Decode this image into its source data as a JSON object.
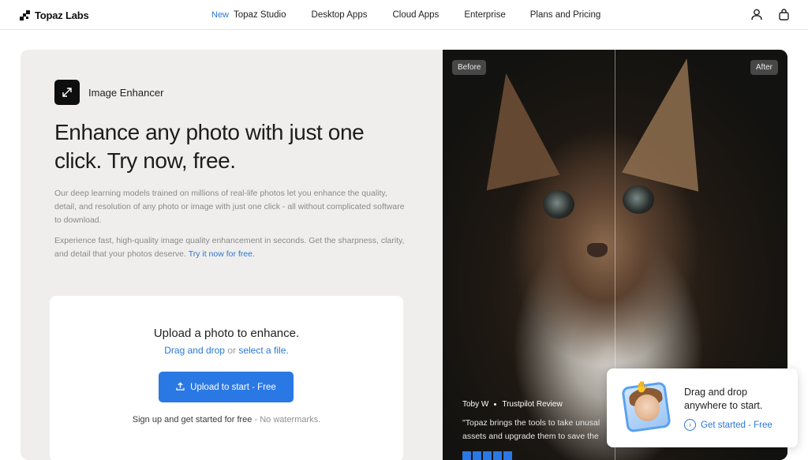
{
  "nav": {
    "logo_text": "Topaz Labs",
    "new_tag": "New",
    "items": [
      {
        "label": "Topaz Studio"
      },
      {
        "label": "Desktop Apps"
      },
      {
        "label": "Cloud Apps"
      },
      {
        "label": "Enterprise"
      },
      {
        "label": "Plans and Pricing"
      }
    ],
    "icons": [
      "user-icon",
      "bag-icon"
    ]
  },
  "hero": {
    "badge_label": "Image Enhancer",
    "badge_icon": "expand-arrows-icon",
    "headline": "Enhance any photo with just one click. Try now, free.",
    "para1": "Our deep learning models trained on millions of real-life photos let you enhance the quality, detail, and resolution of any photo or image with just one click - all without complicated software to download.",
    "para2": "Experience fast, high-quality image quality enhancement in seconds. Get the sharpness, clarity, and detail that your photos deserve.",
    "para2_link": "Try it now for free."
  },
  "upload": {
    "title": "Upload a photo to enhance.",
    "drag_text": "Drag and drop",
    "or_text": "or",
    "select_text": "select a file.",
    "button_label": "Upload to start - Free",
    "button_icon": "upload-icon",
    "note_main": "Sign up and get started for free",
    "note_muted": "- No watermarks."
  },
  "photo": {
    "before_label": "Before",
    "after_label": "After",
    "reviewer": "Toby W",
    "review_source": "Trustpilot Review",
    "review_line1": "\"Topaz brings the tools to take unusal",
    "review_line2": "assets and upgrade them to save the"
  },
  "toast": {
    "title": "Drag and drop anywhere to start.",
    "link": "Get started - Free",
    "link_icon": "arrow-circle-icon"
  },
  "colors": {
    "accent": "#2a78e4",
    "hero_bg": "#efeeec",
    "text": "#1f1f1f"
  }
}
